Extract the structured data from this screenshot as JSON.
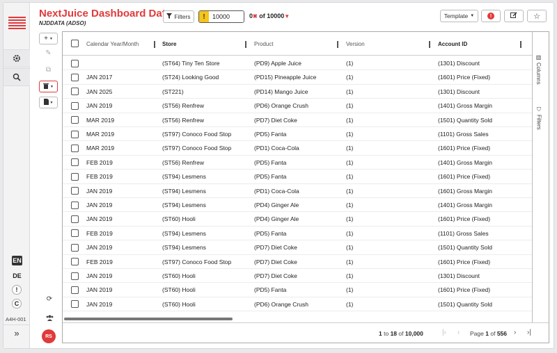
{
  "app": {
    "title": "NextJuice Dashboard Data",
    "subtitle": "NJDDATA (ADSO)"
  },
  "colors": {
    "accent": "#e03a3a",
    "warning": "#f5c518"
  },
  "toolbar": {
    "filters_label": "Filters",
    "rows_value": "10000",
    "of_label": "of 10000",
    "template_label": "Template"
  },
  "leftnav": {
    "languages": [
      "EN",
      "DE"
    ],
    "system_id": "A4H-001",
    "icons": [
      "settings-icon",
      "search-icon",
      "info-icon",
      "copyright-icon",
      "expand-icon"
    ]
  },
  "tools": {
    "icons": [
      "plus-icon",
      "pencil-icon",
      "copy-icon",
      "trash-icon",
      "file-icon",
      "refresh-icon",
      "users-icon"
    ],
    "avatar_initials": "RS"
  },
  "table": {
    "columns": [
      "Calendar Year/Month",
      "Store",
      "Product",
      "Version",
      "Account ID"
    ],
    "rows": [
      [
        "",
        "(ST64) Tiny Ten Store",
        "(PD9) Apple Juice",
        "(1)",
        "(1301) Discount"
      ],
      [
        "JAN 2017",
        "(ST24) Looking Good",
        "(PD15) Pineapple Juice",
        "(1)",
        "(1601) Price (Fixed)"
      ],
      [
        "JAN 2025",
        "(ST221)",
        "(PD14) Mango Juice",
        "(1)",
        "(1301) Discount"
      ],
      [
        "JAN 2019",
        "(ST56) Renfrew",
        "(PD6) Orange Crush",
        "(1)",
        "(1401) Gross Margin"
      ],
      [
        "MAR 2019",
        "(ST56) Renfrew",
        "(PD7) Diet Coke",
        "(1)",
        "(1501) Quantity Sold"
      ],
      [
        "MAR 2019",
        "(ST97) Conoco Food Stop",
        "(PD5) Fanta",
        "(1)",
        "(1101) Gross Sales"
      ],
      [
        "MAR 2019",
        "(ST97) Conoco Food Stop",
        "(PD1) Coca-Cola",
        "(1)",
        "(1601) Price (Fixed)"
      ],
      [
        "FEB 2019",
        "(ST56) Renfrew",
        "(PD5) Fanta",
        "(1)",
        "(1401) Gross Margin"
      ],
      [
        "FEB 2019",
        "(ST94) Lesmens",
        "(PD5) Fanta",
        "(1)",
        "(1601) Price (Fixed)"
      ],
      [
        "JAN 2019",
        "(ST94) Lesmens",
        "(PD1) Coca-Cola",
        "(1)",
        "(1601) Gross Margin"
      ],
      [
        "JAN 2019",
        "(ST94) Lesmens",
        "(PD4) Ginger Ale",
        "(1)",
        "(1401) Gross Margin"
      ],
      [
        "JAN 2019",
        "(ST60) Hooli",
        "(PD4) Ginger Ale",
        "(1)",
        "(1601) Price (Fixed)"
      ],
      [
        "FEB 2019",
        "(ST94) Lesmens",
        "(PD5) Fanta",
        "(1)",
        "(1101) Gross Sales"
      ],
      [
        "JAN 2019",
        "(ST94) Lesmens",
        "(PD7) Diet Coke",
        "(1)",
        "(1501) Quantity Sold"
      ],
      [
        "FEB 2019",
        "(ST97) Conoco Food Stop",
        "(PD7) Diet Coke",
        "(1)",
        "(1601) Price (Fixed)"
      ],
      [
        "JAN 2019",
        "(ST60) Hooli",
        "(PD7) Diet Coke",
        "(1)",
        "(1301) Discount"
      ],
      [
        "JAN 2019",
        "(ST60) Hooli",
        "(PD5) Fanta",
        "(1)",
        "(1601) Price (Fixed)"
      ],
      [
        "JAN 2019",
        "(ST60) Hooli",
        "(PD6) Orange Crush",
        "(1)",
        "(1501) Quantity Sold"
      ]
    ]
  },
  "side_panel": {
    "columns_label": "Columns",
    "filters_label": "Filters"
  },
  "pagination": {
    "range_from": "1",
    "range_to_label": "to",
    "range_to": "18",
    "of_label": "of",
    "total": "10,000",
    "page_label": "Page",
    "page": "1",
    "page_of_label": "of",
    "page_total": "556"
  }
}
